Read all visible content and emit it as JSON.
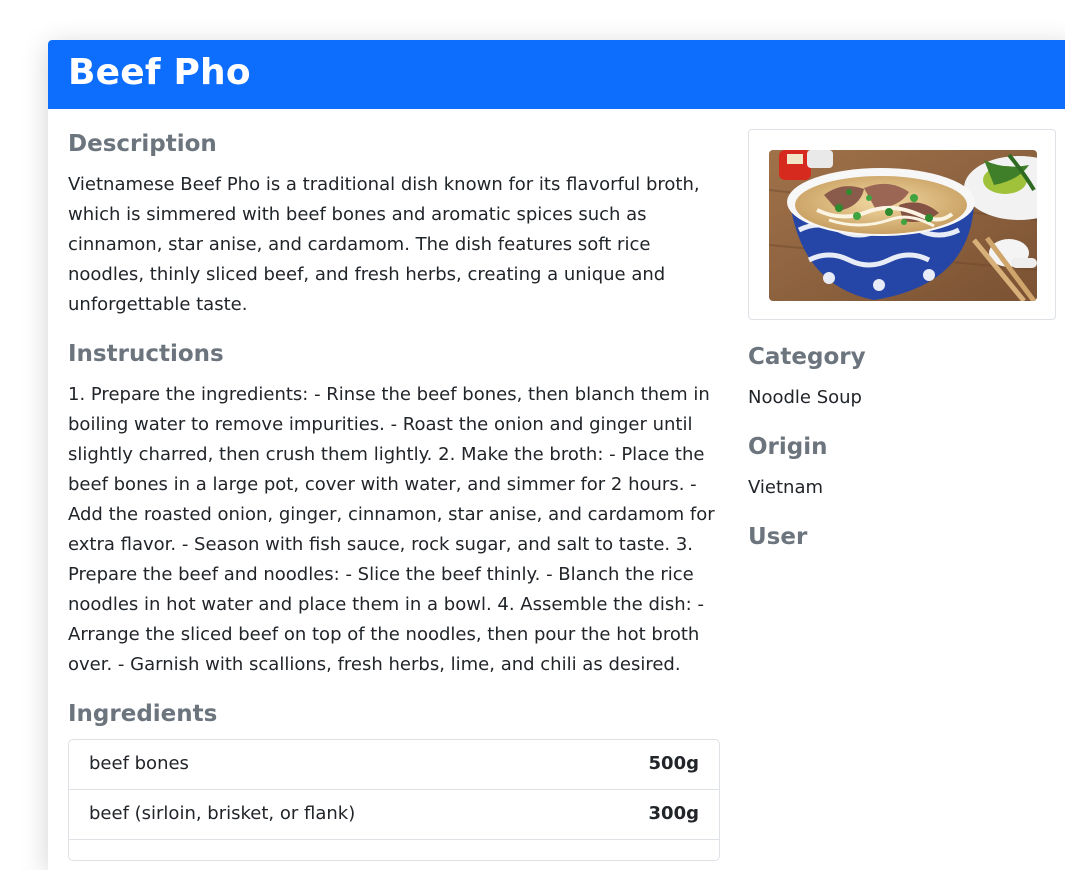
{
  "recipe": {
    "title": "Beef Pho",
    "description_heading": "Description",
    "description": "Vietnamese Beef Pho is a traditional dish known for its flavorful broth, which is simmered with beef bones and aromatic spices such as cinnamon, star anise, and cardamom. The dish features soft rice noodles, thinly sliced beef, and fresh herbs, creating a unique and unforgettable taste.",
    "instructions_heading": "Instructions",
    "instructions": "1. Prepare the ingredients: - Rinse the beef bones, then blanch them in boiling water to remove impurities. - Roast the onion and ginger until slightly charred, then crush them lightly. 2. Make the broth: - Place the beef bones in a large pot, cover with water, and simmer for 2 hours. - Add the roasted onion, ginger, cinnamon, star anise, and cardamom for extra flavor. - Season with fish sauce, rock sugar, and salt to taste. 3. Prepare the beef and noodles: - Slice the beef thinly. - Blanch the rice noodles in hot water and place them in a bowl. 4. Assemble the dish: - Arrange the sliced beef on top of the noodles, then pour the hot broth over. - Garnish with scallions, fresh herbs, lime, and chili as desired.",
    "ingredients_heading": "Ingredients",
    "ingredients": [
      {
        "name": "beef bones",
        "quantity": "500g"
      },
      {
        "name": "beef (sirloin, brisket, or flank)",
        "quantity": "300g"
      }
    ],
    "category_heading": "Category",
    "category": "Noodle Soup",
    "origin_heading": "Origin",
    "origin": "Vietnam",
    "user_heading": "User",
    "image_alt": "Beef Pho"
  },
  "colors": {
    "header_bg": "#0d6efd",
    "heading_text": "#6c757d",
    "body_text": "#212529",
    "border": "#dee2e6"
  }
}
